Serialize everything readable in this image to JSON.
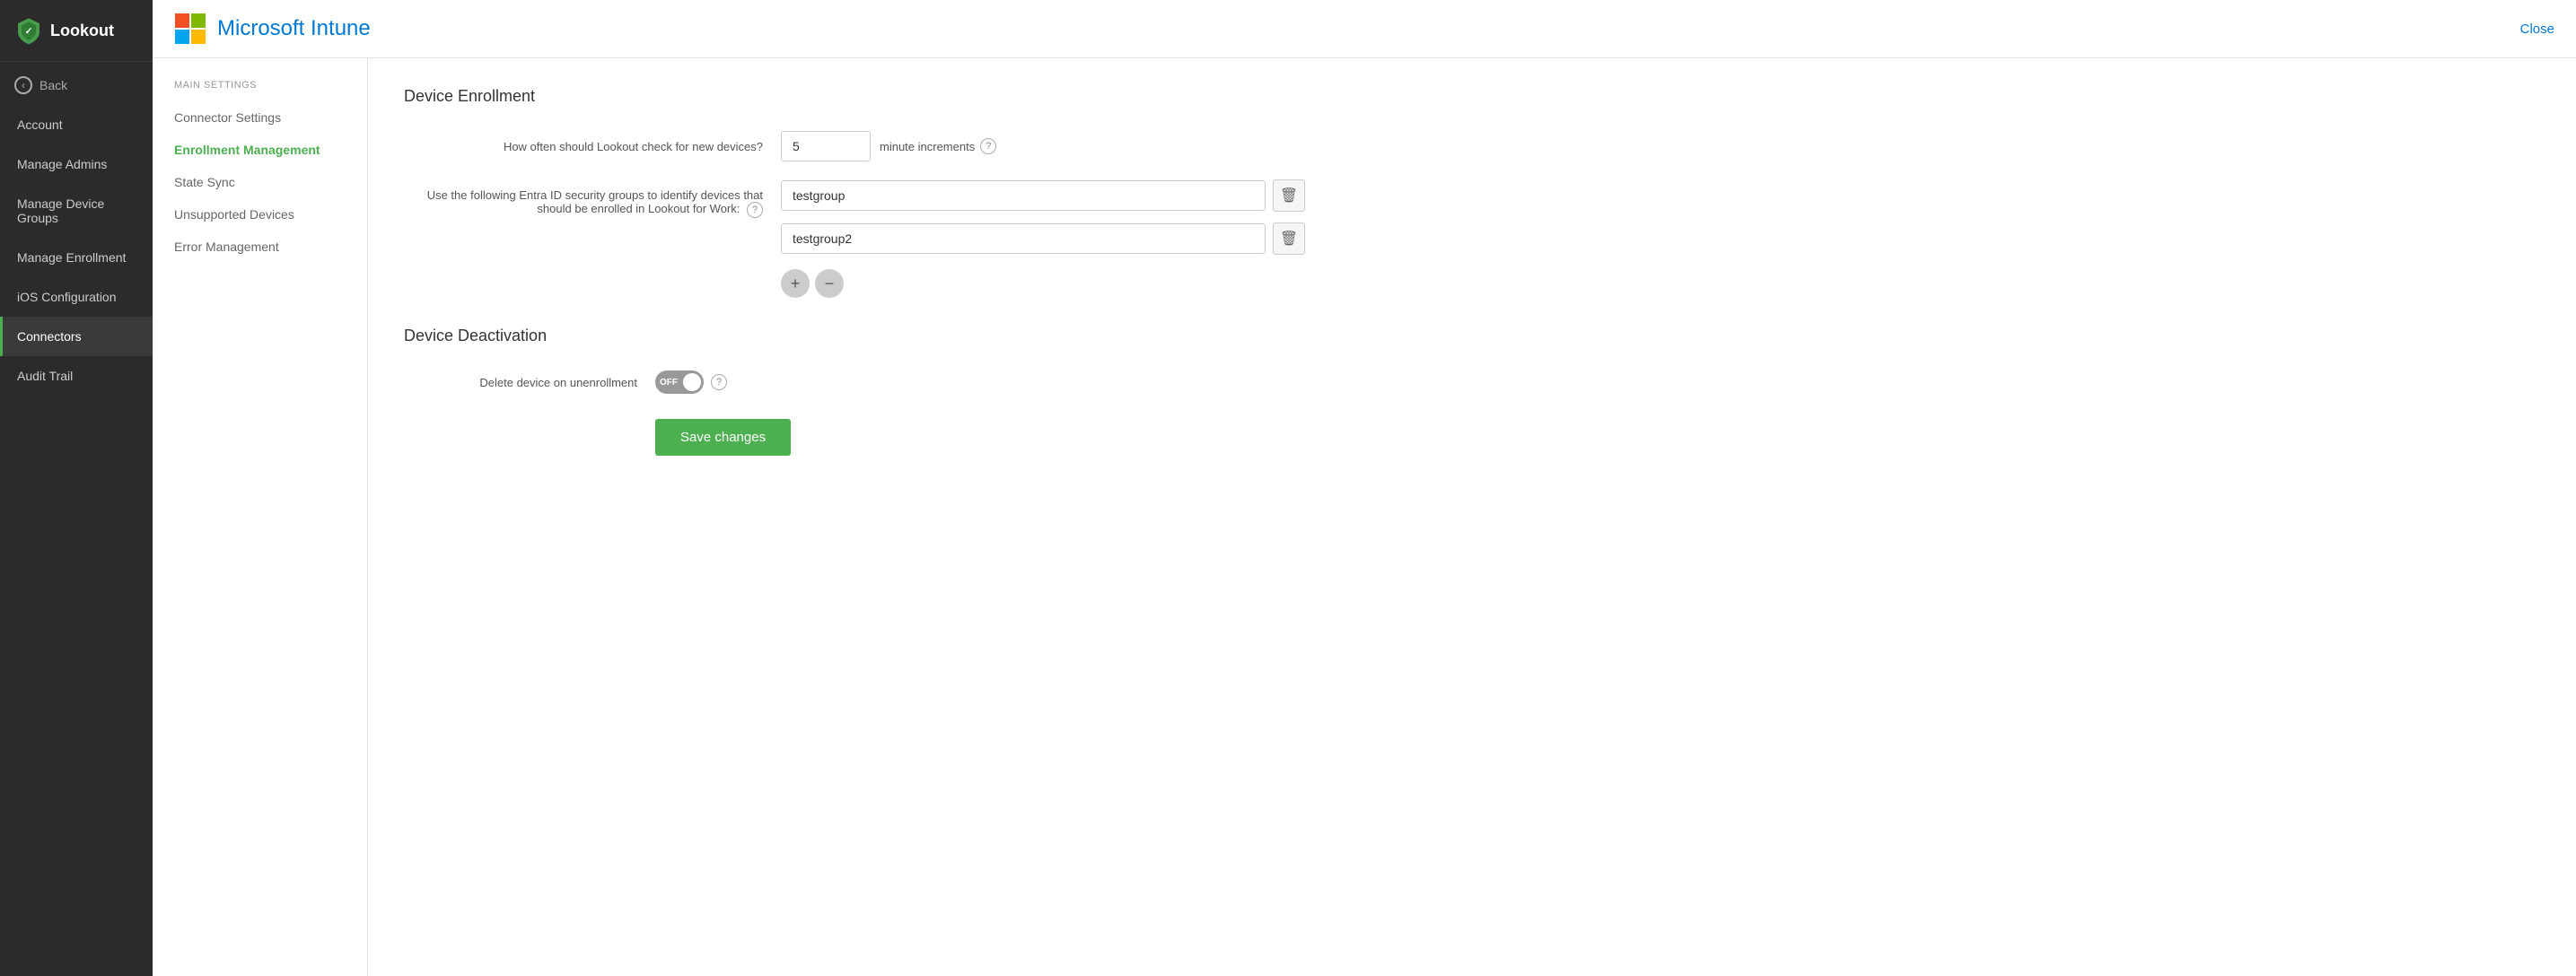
{
  "sidebar": {
    "logo_text": "Lookout",
    "back_label": "Back",
    "items": [
      {
        "id": "account",
        "label": "Account",
        "active": false
      },
      {
        "id": "manage-admins",
        "label": "Manage Admins",
        "active": false
      },
      {
        "id": "manage-device-groups",
        "label": "Manage Device Groups",
        "active": false
      },
      {
        "id": "manage-enrollment",
        "label": "Manage Enrollment",
        "active": false
      },
      {
        "id": "ios-configuration",
        "label": "iOS Configuration",
        "active": false
      },
      {
        "id": "connectors",
        "label": "Connectors",
        "active": true
      },
      {
        "id": "audit-trail",
        "label": "Audit Trail",
        "active": false
      }
    ]
  },
  "header": {
    "title": "Microsoft Intune",
    "close_label": "Close"
  },
  "settings_nav": {
    "section_label": "MAIN SETTINGS",
    "items": [
      {
        "id": "connector-settings",
        "label": "Connector Settings",
        "active": false
      },
      {
        "id": "enrollment-management",
        "label": "Enrollment Management",
        "active": true
      },
      {
        "id": "state-sync",
        "label": "State Sync",
        "active": false
      },
      {
        "id": "unsupported-devices",
        "label": "Unsupported Devices",
        "active": false
      },
      {
        "id": "error-management",
        "label": "Error Management",
        "active": false
      }
    ]
  },
  "device_enrollment": {
    "section_title": "Device Enrollment",
    "frequency_label": "How often should Lookout check for new devices?",
    "frequency_value": "5",
    "frequency_unit": "minute increments",
    "groups_label": "Use the following Entra ID security groups to identify devices that should be enrolled in Lookout for Work:",
    "groups": [
      {
        "id": "group1",
        "value": "testgroup"
      },
      {
        "id": "group2",
        "value": "testgroup2"
      }
    ],
    "add_label": "+",
    "remove_label": "−"
  },
  "device_deactivation": {
    "section_title": "Device Deactivation",
    "delete_label": "Delete device on unenrollment",
    "toggle_state": "OFF"
  },
  "actions": {
    "save_label": "Save changes"
  },
  "icons": {
    "back_arrow": "‹",
    "delete": "🗑",
    "question": "?",
    "plus": "+",
    "minus": "−"
  }
}
